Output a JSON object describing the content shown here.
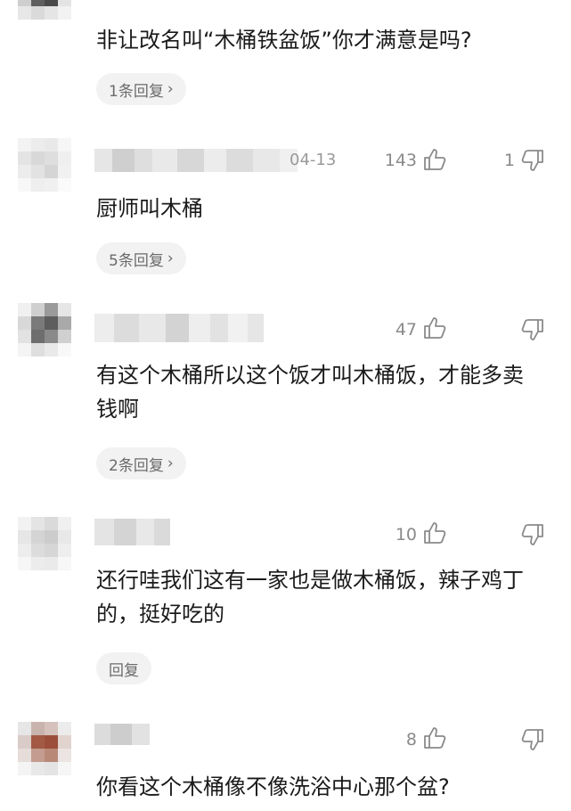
{
  "comments": [
    {
      "date": "",
      "likes": "",
      "dislikes": "",
      "text": "非让改名叫“木桶铁盆饭”你才满意是吗?",
      "reply_label": "1条回复",
      "has_chevron": true
    },
    {
      "date": "04-13",
      "likes": "143",
      "dislikes": "1",
      "text": "厨师叫木桶",
      "reply_label": "5条回复",
      "has_chevron": true
    },
    {
      "date": "",
      "likes": "47",
      "dislikes": "",
      "text": "有这个木桶所以这个饭才叫木桶饭，才能多卖钱啊",
      "reply_label": "2条回复",
      "has_chevron": true
    },
    {
      "date": "",
      "likes": "10",
      "dislikes": "",
      "text": "还行哇我们这有一家也是做木桶饭，辣子鸡丁的，挺好吃的",
      "reply_label": "回复",
      "has_chevron": false
    },
    {
      "date": "",
      "likes": "8",
      "dislikes": "",
      "text": "你看这个木桶像不像洗浴中心那个盆?",
      "reply_label": "",
      "has_chevron": false
    }
  ],
  "icons": {
    "like": "thumbs-up-icon",
    "dislike": "thumbs-down-icon",
    "chevron": "chevron-right-icon"
  },
  "colors": {
    "text": "#1a1a1a",
    "meta": "#8a8a8a",
    "pill": "#f2f2f2"
  }
}
